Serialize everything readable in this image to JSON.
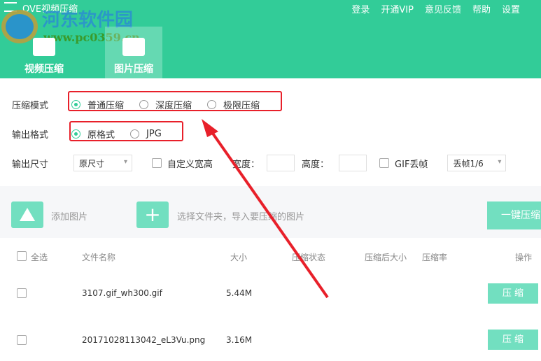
{
  "app": {
    "title": "OVE视频压缩",
    "watermark": "河东软件园",
    "watermark_url": "www.pc0359.cn"
  },
  "topnav": [
    "登录",
    "开通VIP",
    "意见反馈",
    "帮助",
    "设置"
  ],
  "tabs": [
    {
      "label": "视频压缩",
      "active": false
    },
    {
      "label": "图片压缩",
      "active": true
    }
  ],
  "settings": {
    "mode_label": "压缩模式",
    "modes": [
      {
        "label": "普通压缩",
        "checked": true
      },
      {
        "label": "深度压缩",
        "checked": false
      },
      {
        "label": "极限压缩",
        "checked": false
      }
    ],
    "format_label": "输出格式",
    "formats": [
      {
        "label": "原格式",
        "checked": true
      },
      {
        "label": "JPG",
        "checked": false
      }
    ],
    "size_label": "输出尺寸",
    "size_value": "原尺寸",
    "custom_label": "自定义宽高",
    "width_label": "宽度：",
    "height_label": "高度：",
    "gif_label": "GIF丢帧",
    "gif_value": "丢帧1/6"
  },
  "toolbar": {
    "add_image": "添加图片",
    "add_folder": "选择文件夹，导入要压缩的图片",
    "compress_all": "一键压缩"
  },
  "table": {
    "headers": [
      "全选",
      "文件名称",
      "大小",
      "压缩状态",
      "压缩后大小",
      "压缩率",
      "操作"
    ],
    "rows": [
      {
        "name": "3107.gif_wh300.gif",
        "size": "5.44M",
        "action": "压 缩"
      },
      {
        "name": "20171028113042_eL3Vu.png",
        "size": "3.16M",
        "action": "压 缩"
      }
    ]
  },
  "colors": {
    "accent": "#32cc98",
    "button": "#72dfc0",
    "annotation": "#e8202a"
  }
}
